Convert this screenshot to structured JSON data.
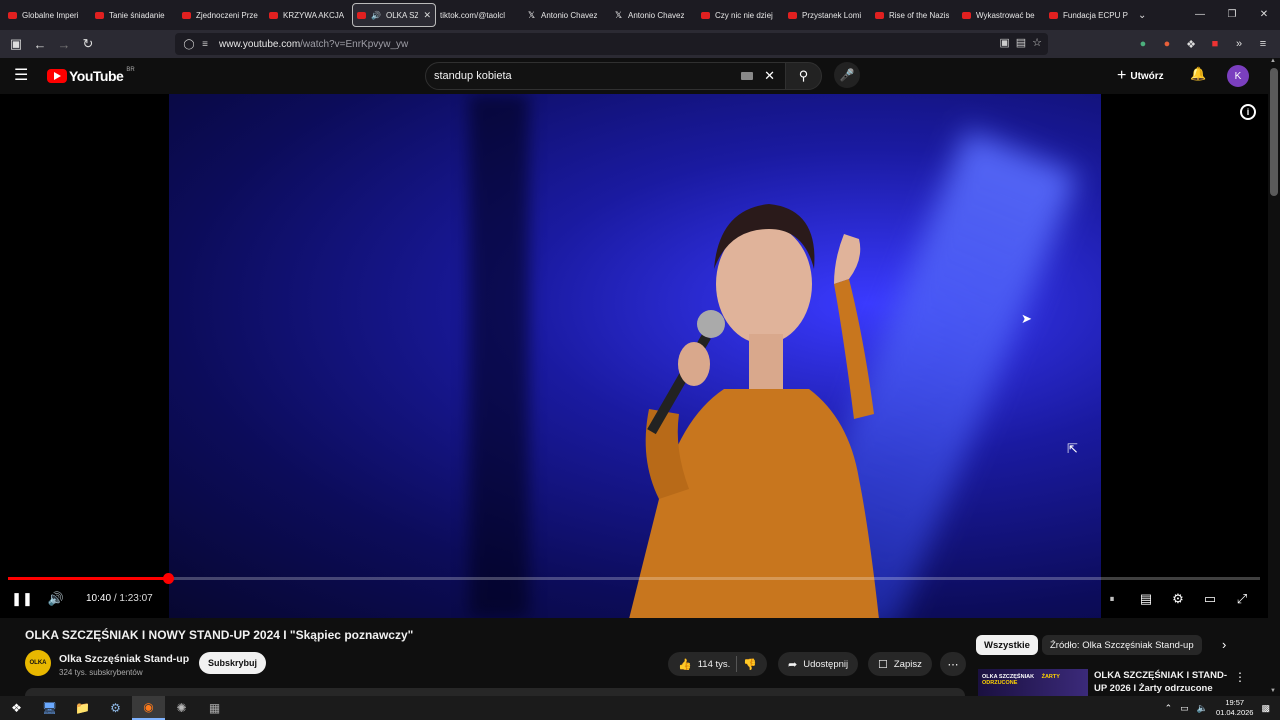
{
  "browser": {
    "tabs": [
      {
        "title": "Globalne Imperi",
        "icon": "youtube"
      },
      {
        "title": "Tanie śniadanie",
        "icon": "youtube"
      },
      {
        "title": "Zjednoczeni Prze",
        "icon": "youtube"
      },
      {
        "title": "KRZYWA AKCJA",
        "icon": "youtube"
      },
      {
        "title": "OLKA SZC",
        "icon": "youtube",
        "active": true
      },
      {
        "title": "tiktok.com/@taolcl",
        "icon": "none"
      },
      {
        "title": "Antonio Chavez",
        "icon": "x"
      },
      {
        "title": "Antonio Chavez",
        "icon": "x"
      },
      {
        "title": "Czy nic nie dziej",
        "icon": "youtube"
      },
      {
        "title": "Przystanek Lomi",
        "icon": "youtube"
      },
      {
        "title": "Rise of the Nazis",
        "icon": "youtube"
      },
      {
        "title": "Wykastrować be",
        "icon": "youtube"
      },
      {
        "title": "Fundacja ECPU P",
        "icon": "youtube"
      }
    ],
    "url_prefix": "www.youtube.com",
    "url_rest": "/watch?v=EnrKpvyw_yw"
  },
  "youtube": {
    "country_code": "BR",
    "logo_text": "YouTube",
    "search_value": "standup kobieta",
    "create_label": "Utwórz",
    "avatar_letter": "K"
  },
  "player": {
    "current_time": "10:40",
    "duration": "1:23:07",
    "progress_fraction": 0.128
  },
  "video": {
    "title": "OLKA SZCZĘŚNIAK I NOWY STAND-UP 2024 I \"Skąpiec poznawczy\"",
    "channel_name": "Olka Szczęśniak Stand-up",
    "channel_avatar_text": "OLKA",
    "subscribers": "324 tys. subskrybentów",
    "subscribe_label": "Subskrybuj",
    "likes": "114 tys.",
    "share_label": "Udostępnij",
    "save_label": "Zapisz"
  },
  "recommendations": {
    "chips": [
      "Wszystkie",
      "Źródło: Olka Szczęśniak Stand-up"
    ],
    "first": {
      "title": "OLKA SZCZĘŚNIAK I STAND-UP 2026 I Żarty odrzucone",
      "thumb_text_a": "OLKA SZCZĘŚNIAK",
      "thumb_text_b": "ŻARTY ODRZUCONE"
    }
  },
  "taskbar": {
    "time": "19:57",
    "date": "01.04.2026"
  },
  "colors": {
    "brand": "#ff0000",
    "background": "#0f0f0f",
    "avatar": "#7b3fbf"
  }
}
